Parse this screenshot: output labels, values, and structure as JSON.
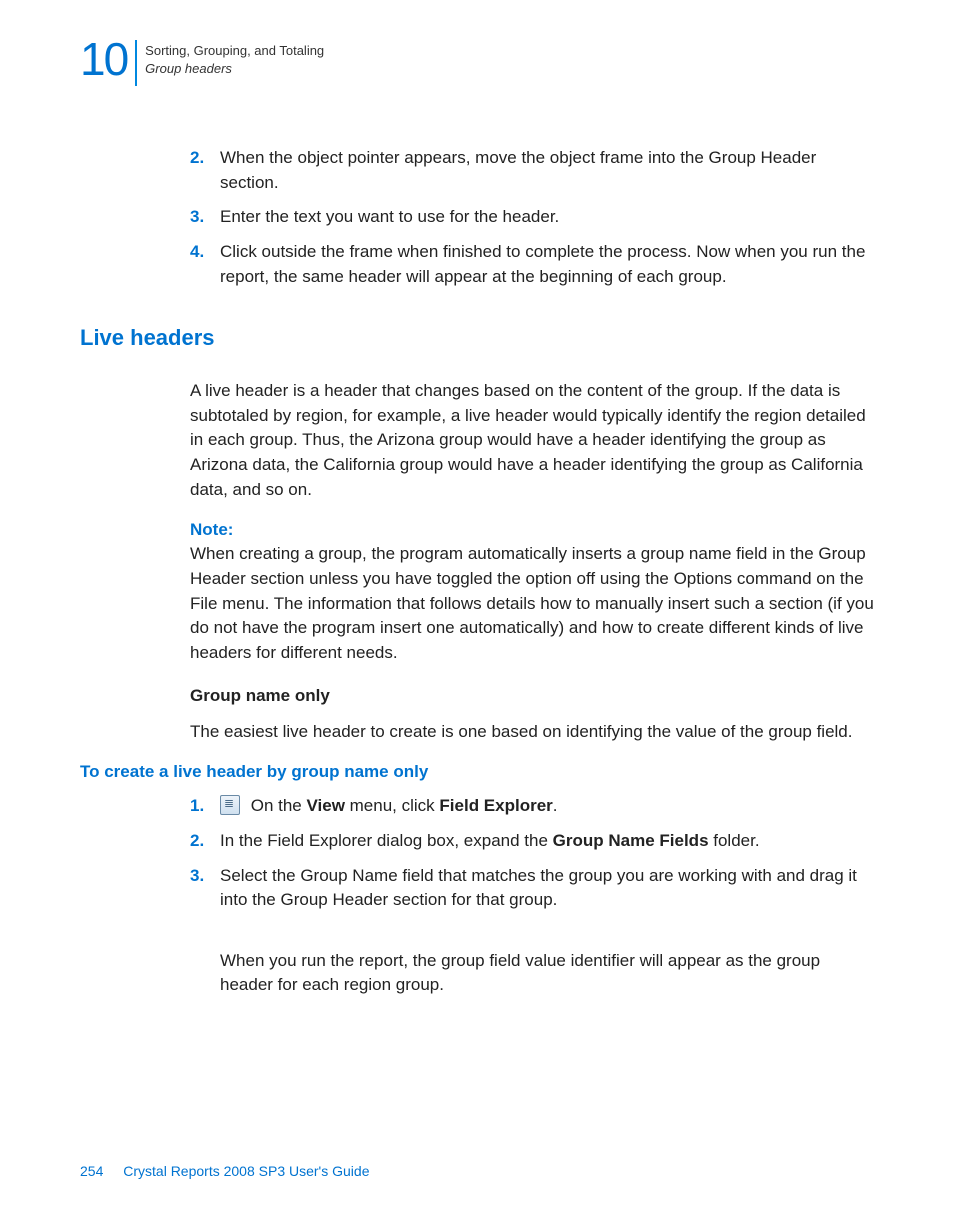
{
  "header": {
    "chapter_number": "10",
    "line1": "Sorting, Grouping, and Totaling",
    "line2": "Group headers"
  },
  "steps_a": [
    {
      "n": "2.",
      "t": "When the object pointer appears, move the object frame into the Group Header section."
    },
    {
      "n": "3.",
      "t": "Enter the text you want to use for the header."
    },
    {
      "n": "4.",
      "t": "Click outside the frame when finished to complete the process. Now when you run the report, the same header will appear at the beginning of each group."
    }
  ],
  "section_title": "Live headers",
  "para1": "A live header is a header that changes based on the content of the group. If the data is subtotaled by region, for example, a live header would typically identify the region detailed in each group. Thus, the Arizona group would have a header identifying the group as Arizona data, the California group would have a header identifying the group as California data, and so on.",
  "note_label": "Note:",
  "note_text": "When creating a group, the program automatically inserts a group name field in the Group Header section unless you have toggled the option off using the Options command on the File menu. The information that follows details how to manually insert such a section (if you do not have the program insert one automatically) and how to create different kinds of live headers for different needs.",
  "subhead": "Group name only",
  "para2": "The easiest live header to create is one based on identifying the value of the group field.",
  "proc_title": "To create a live header by group name only",
  "steps_b": {
    "s1": {
      "n": "1.",
      "pre": " On the ",
      "bold1": "View",
      "mid": " menu, click ",
      "bold2": "Field Explorer",
      "post": "."
    },
    "s2": {
      "n": "2.",
      "pre": "In the Field Explorer dialog box, expand the ",
      "bold1": "Group Name Fields",
      "post": " folder."
    },
    "s3": {
      "n": "3.",
      "t": "Select the Group Name field that matches the group you are working with and drag it into the Group Header section for that group."
    }
  },
  "result": "When you run the report, the group field value identifier will appear as the group header for each region group.",
  "footer": {
    "page": "254",
    "title": "Crystal Reports 2008 SP3 User's Guide"
  }
}
